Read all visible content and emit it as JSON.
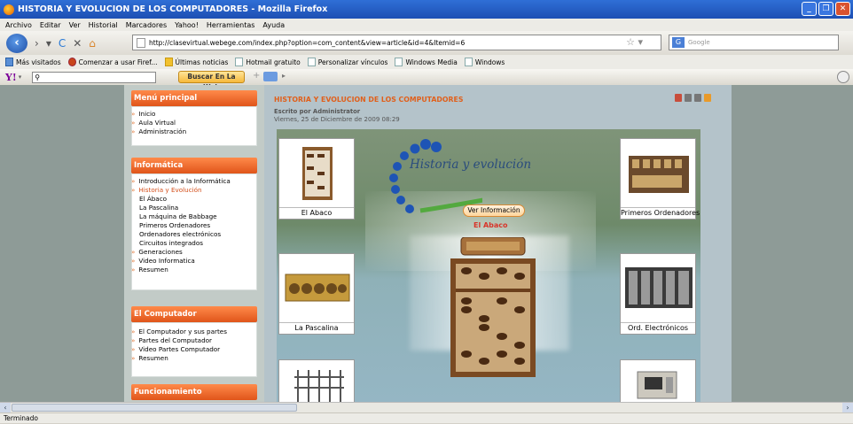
{
  "window": {
    "title": "HISTORIA Y EVOLUCION DE LOS COMPUTADORES - Mozilla Firefox"
  },
  "menubar": [
    "Archivo",
    "Editar",
    "Ver",
    "Historial",
    "Marcadores",
    "Yahoo!",
    "Herramientas",
    "Ayuda"
  ],
  "navbar": {
    "url": "http://clasevirtual.webege.com/index.php?option=com_content&view=article&id=4&Itemid=6",
    "search_placeholder": "Google"
  },
  "bookmarks": [
    "Más visitados",
    "Comenzar a usar Firef...",
    "Últimas noticias",
    "Hotmail gratuito",
    "Personalizar vínculos",
    "Windows Media",
    "Windows"
  ],
  "yahoo_toolbar": {
    "logo": "Y!",
    "button": "Buscar En La Web"
  },
  "sidebar": {
    "menu_principal": {
      "title": "Menú principal",
      "items": [
        "Inicio",
        "Aula Virtual",
        "Administración"
      ]
    },
    "informatica": {
      "title": "Informática",
      "items": [
        {
          "label": "Introducción a la Informática"
        },
        {
          "label": "Historia y Evolución"
        },
        {
          "label": "El Ábaco"
        },
        {
          "label": "La Pascalina"
        },
        {
          "label": "La máquina de Babbage"
        },
        {
          "label": "Primeros Ordenadores"
        },
        {
          "label": "Ordenadores electrónicos"
        },
        {
          "label": "Circuitos integrados"
        },
        {
          "label": "Generaciones"
        },
        {
          "label": "Video Informatica"
        },
        {
          "label": "Resumen"
        }
      ]
    },
    "computador": {
      "title": "El Computador",
      "items": [
        "El Computador y sus partes",
        "Partes del Computador",
        "Video Partes Computador",
        "Resumen"
      ]
    },
    "funcionamiento": {
      "title": "Funcionamiento"
    }
  },
  "article": {
    "title": "HISTORIA Y EVOLUCION DE LOS COMPUTADORES",
    "author": "Escrito por Administrator",
    "date": "Viernes, 25 de Diciembre de 2009 08:29"
  },
  "flash": {
    "heading": "Historia y evolución",
    "button": "Ver Información",
    "current": "El Abaco",
    "cards": [
      "El Abaco",
      "Primeros Ordenadores",
      "La Pascalina",
      "Ord. Electrónicos"
    ]
  },
  "status": "Terminado"
}
